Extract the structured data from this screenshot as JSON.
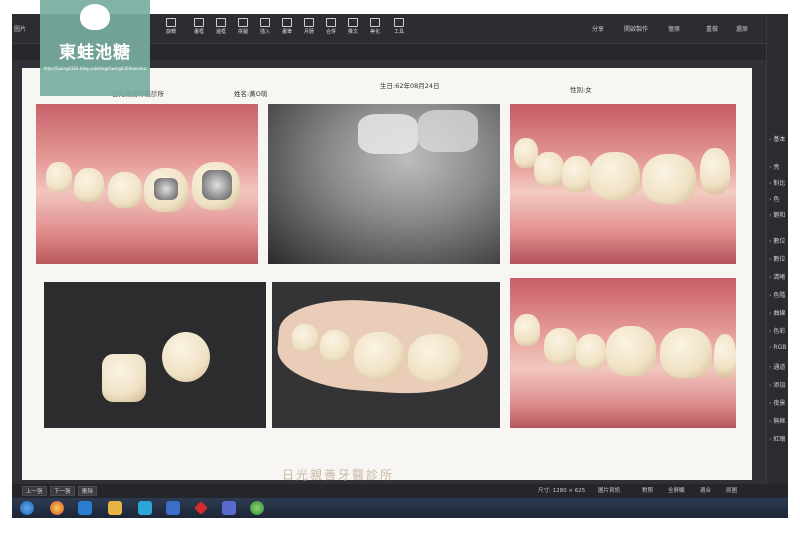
{
  "toolbar": {
    "left_label": "圖片",
    "buttons": [
      "旋轉",
      "畫框",
      "邊框",
      "拼圖",
      "插入",
      "畫筆",
      "月曆",
      "合併",
      "推文",
      "美化",
      "工具"
    ],
    "right": [
      "分享",
      "開啟製作",
      "復原",
      "重做",
      "還原"
    ]
  },
  "header": {
    "clinic": "日光親善牙醫診所",
    "name": "姓名:黃O萌",
    "birth": "生日:62年08月24日",
    "gender": "性別:女"
  },
  "footer_text": "日光親善牙醫診所",
  "right_panel": {
    "top_label": "基本",
    "items": [
      "亮",
      "對比",
      "色",
      "飽和",
      "數位",
      "數位",
      "清晰",
      "色階",
      "曲線",
      "色彩",
      "RGB",
      "通道",
      "添加",
      "夜景",
      "無框",
      "紅眼"
    ]
  },
  "bottom_bar": {
    "buttons": [
      "上一張",
      "下一張",
      "刪除"
    ],
    "size": "尺寸: 1280 × 625",
    "right": [
      "圖片資訊",
      "對照",
      "全屏顯",
      "適合",
      "原圖"
    ]
  },
  "watermark": {
    "title": "東蛙池糖",
    "url": "http://Gwing0304.blog.sub/blog/Gwing0304/ameba"
  },
  "colors": {
    "toolbar_bg": "#2b2d33",
    "document_bg": "#f7f6f3",
    "watermark_bg": "#78aca0"
  }
}
